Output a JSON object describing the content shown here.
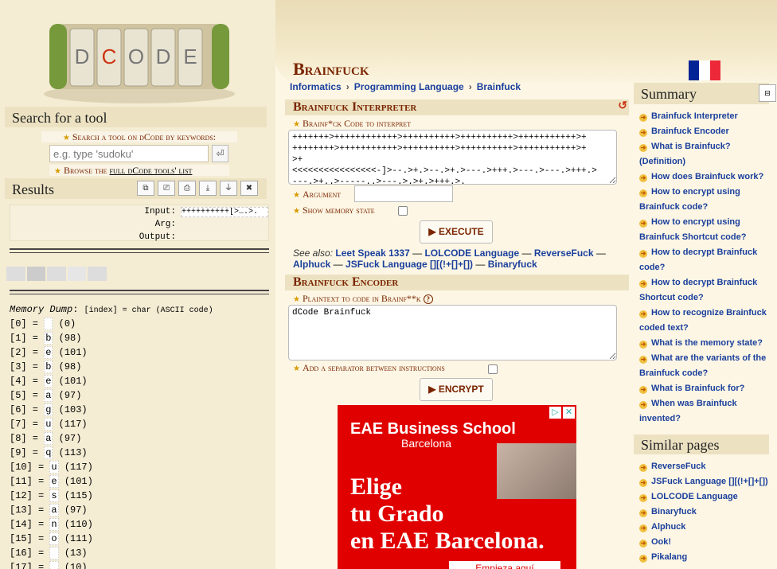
{
  "logo": {
    "text": "dCODE"
  },
  "search": {
    "title": "Search for a tool",
    "prompt": "Search a tool on dCode by keywords:",
    "placeholder": "e.g. type 'sudoku'",
    "go_symbol": "⏎",
    "browse_prefix": "Browse the",
    "browse_link": "full dCode tools' list"
  },
  "results": {
    "title": "Results",
    "tools": [
      "⧉",
      "⎚",
      "⎙",
      "⤓",
      "⏚",
      "✖"
    ],
    "input_label": "Input:",
    "input_value": "++++++++++[>….>.",
    "arg_label": "Arg:",
    "arg_value": "",
    "output_label": "Output:",
    "output_value": ""
  },
  "memory": {
    "title": "Memory Dump",
    "legend": "[index] = char (ASCII code)",
    "rows": [
      {
        "idx": "[0]",
        "ch": " ",
        "code": "(0)"
      },
      {
        "idx": "[1]",
        "ch": "b",
        "code": "(98)"
      },
      {
        "idx": "[2]",
        "ch": "e",
        "code": "(101)"
      },
      {
        "idx": "[3]",
        "ch": "b",
        "code": "(98)"
      },
      {
        "idx": "[4]",
        "ch": "e",
        "code": "(101)"
      },
      {
        "idx": "[5]",
        "ch": "a",
        "code": "(97)"
      },
      {
        "idx": "[6]",
        "ch": "g",
        "code": "(103)"
      },
      {
        "idx": "[7]",
        "ch": "u",
        "code": "(117)"
      },
      {
        "idx": "[8]",
        "ch": "a",
        "code": "(97)"
      },
      {
        "idx": "[9]",
        "ch": "q",
        "code": "(113)"
      },
      {
        "idx": "[10]",
        "ch": "u",
        "code": "(117)"
      },
      {
        "idx": "[11]",
        "ch": "e",
        "code": "(101)"
      },
      {
        "idx": "[12]",
        "ch": "s",
        "code": "(115)"
      },
      {
        "idx": "[13]",
        "ch": "a",
        "code": "(97)"
      },
      {
        "idx": "[14]",
        "ch": "n",
        "code": "(110)"
      },
      {
        "idx": "[15]",
        "ch": "o",
        "code": "(111)"
      },
      {
        "idx": "[16]",
        "ch": " ",
        "code": "(13)"
      },
      {
        "idx": "[17]",
        "ch": " ",
        "code": "(10)"
      }
    ]
  },
  "page": {
    "title": "Brainfuck",
    "breadcrumb": [
      "Informatics",
      "Programming Language",
      "Brainfuck"
    ],
    "breadcrumb_sep": "›"
  },
  "interpreter": {
    "title": "Brainfuck Interpreter",
    "reset_symbol": "↺",
    "code_label": "Brainf*ck Code to interpret",
    "code_value": "+++++++>++++++++++++>++++++++++>++++++++++>+++++++++++>+\n++++++++>+++++++++++>++++++++++>++++++++++>+++++++++++>+\n>+\n<<<<<<<<<<<<<<<<-]>--.>+.>--.>+.>---.>+++.>---.>---.>+++.>\n---.>+..>-----..>---.>.>+.>+++.>.",
    "argument_label": "Argument",
    "argument_value": "",
    "memory_label": "Show memory state",
    "execute_label": "▶ EXECUTE",
    "seealso_label": "See also:",
    "seealso_links": [
      "Leet Speak 1337",
      "LOLCODE Language",
      "ReverseFuck",
      "Alphuck",
      "JSFuck Language [][(!+[]+[])",
      "Binaryfuck"
    ]
  },
  "encoder": {
    "title": "Brainfuck Encoder",
    "text_label": "Plaintext to code in Brainf**k",
    "help_symbol": "?",
    "text_value": "dCode Brainfuck",
    "separator_label": "Add a separator between instructions",
    "encrypt_label": "▶ ENCRYPT"
  },
  "ad": {
    "brand": "EAE Business School",
    "brand_sub": "Barcelona",
    "headline_1": "Elige",
    "headline_2": "tu Grado",
    "headline_3": "en EAE Barcelona.",
    "cta": "Empieza aquí"
  },
  "summary": {
    "title": "Summary",
    "toggle": "⊟",
    "items": [
      "Brainfuck Interpreter",
      "Brainfuck Encoder",
      "What is Brainfuck? (Definition)",
      "How does Brainfuck work?",
      "How to encrypt using Brainfuck code?",
      "How to encrypt using Brainfuck Shortcut code?",
      "How to decrypt Brainfuck code?",
      "How to decrypt Brainfuck Shortcut code?",
      "How to recognize Brainfuck coded text?",
      "What is the memory state?",
      "What are the variants of the Brainfuck code?",
      "What is Brainfuck for?",
      "When was Brainfuck invented?"
    ]
  },
  "similar": {
    "title": "Similar pages",
    "items": [
      "ReverseFuck",
      "JSFuck Language [][(!+[]+[])",
      "LOLCODE Language",
      "Binaryfuck",
      "Alphuck",
      "Ook!",
      "Pikalang"
    ]
  },
  "colors": {
    "accent": "#7a2500",
    "link": "#1a3f9c",
    "panel": "#ece2c2",
    "ad_red": "#e00000",
    "flag_blue": "#002395",
    "flag_red": "#ed2939"
  }
}
